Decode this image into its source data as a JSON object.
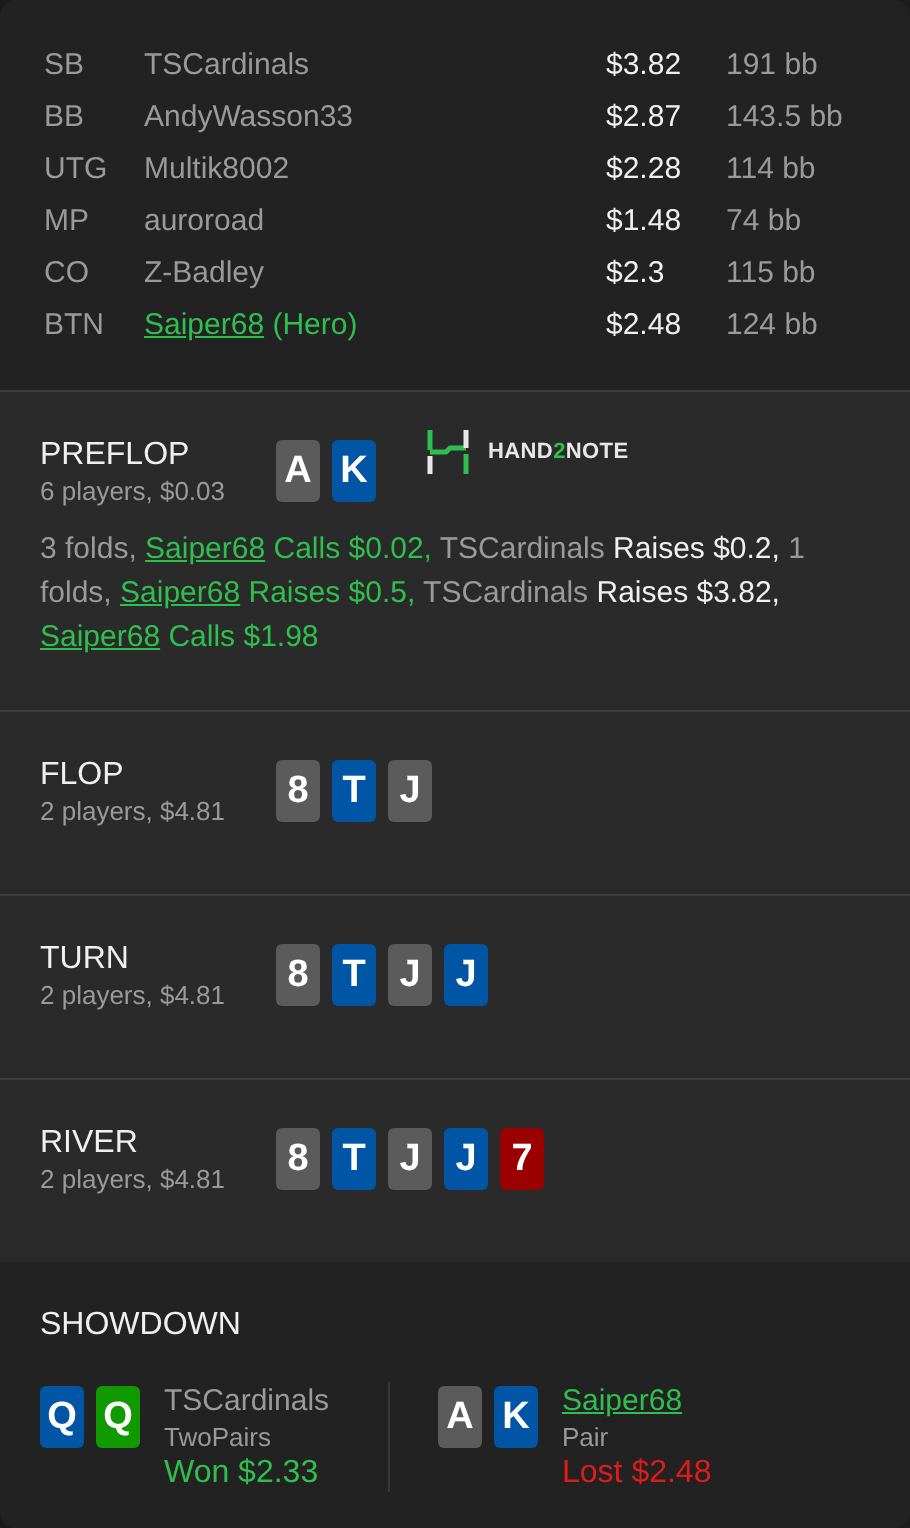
{
  "players": [
    {
      "position": "SB",
      "name": "TSCardinals",
      "hero": false,
      "stack": "$3.82",
      "bb": "191 bb"
    },
    {
      "position": "BB",
      "name": "AndyWasson33",
      "hero": false,
      "stack": "$2.87",
      "bb": "143.5 bb"
    },
    {
      "position": "UTG",
      "name": "Multik8002",
      "hero": false,
      "stack": "$2.28",
      "bb": "114 bb"
    },
    {
      "position": "MP",
      "name": "auroroad",
      "hero": false,
      "stack": "$1.48",
      "bb": "74 bb"
    },
    {
      "position": "CO",
      "name": "Z-Badley",
      "hero": false,
      "stack": "$2.3",
      "bb": "115 bb"
    },
    {
      "position": "BTN",
      "name": "Saiper68",
      "hero": true,
      "note": "(Hero)",
      "stack": "$2.48",
      "bb": "124 bb"
    }
  ],
  "streets": [
    {
      "name": "PREFLOP",
      "info": "6 players, $0.03",
      "cards": [
        {
          "rank": "A",
          "color": "#5b5b5b"
        },
        {
          "rank": "K",
          "color": "#0055a5"
        }
      ],
      "logo": {
        "prefix": "HAND",
        "accent": "2",
        "suffix": "NOTE"
      },
      "actions": [
        {
          "kind": "muted",
          "text": "3 folds, "
        },
        {
          "kind": "link",
          "text": "Saiper68"
        },
        {
          "kind": "hero",
          "text": " Calls $0.02, "
        },
        {
          "kind": "muted",
          "text": "TSCardinals"
        },
        {
          "kind": "strong",
          "text": " Raises $0.2, "
        },
        {
          "kind": "muted",
          "text": "1 folds, "
        },
        {
          "kind": "link",
          "text": "Saiper68"
        },
        {
          "kind": "hero",
          "text": " Raises $0.5, "
        },
        {
          "kind": "muted",
          "text": "TSCardinals"
        },
        {
          "kind": "strong",
          "text": " Raises $3.82, "
        },
        {
          "kind": "link",
          "text": "Saiper68"
        },
        {
          "kind": "hero",
          "text": " Calls $1.98"
        }
      ]
    },
    {
      "name": "FLOP",
      "info": "2 players, $4.81",
      "cards": [
        {
          "rank": "8",
          "color": "#5b5b5b"
        },
        {
          "rank": "T",
          "color": "#0055a5"
        },
        {
          "rank": "J",
          "color": "#5b5b5b"
        }
      ]
    },
    {
      "name": "TURN",
      "info": "2 players, $4.81",
      "cards": [
        {
          "rank": "8",
          "color": "#5b5b5b"
        },
        {
          "rank": "T",
          "color": "#0055a5"
        },
        {
          "rank": "J",
          "color": "#5b5b5b"
        },
        {
          "rank": "J",
          "color": "#0055a5"
        }
      ]
    },
    {
      "name": "RIVER",
      "info": "2 players, $4.81",
      "cards": [
        {
          "rank": "8",
          "color": "#5b5b5b"
        },
        {
          "rank": "T",
          "color": "#0055a5"
        },
        {
          "rank": "J",
          "color": "#5b5b5b"
        },
        {
          "rank": "J",
          "color": "#0055a5"
        },
        {
          "rank": "7",
          "color": "#9b0000"
        }
      ]
    }
  ],
  "showdown": {
    "title": "SHOWDOWN",
    "hands": [
      {
        "cards": [
          {
            "rank": "Q",
            "color": "#0055a5"
          },
          {
            "rank": "Q",
            "color": "#119900"
          }
        ],
        "name": "TSCardinals",
        "hero": false,
        "hand": "TwoPairs",
        "result": "Won $2.33",
        "won": true
      },
      {
        "cards": [
          {
            "rank": "A",
            "color": "#5b5b5b"
          },
          {
            "rank": "K",
            "color": "#0055a5"
          }
        ],
        "name": "Saiper68",
        "hero": true,
        "hand": "Pair",
        "result": "Lost $2.48",
        "won": false
      }
    ]
  }
}
